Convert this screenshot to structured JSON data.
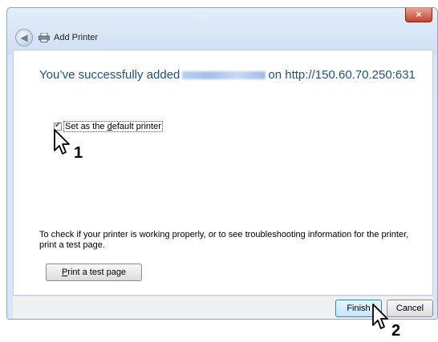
{
  "window": {
    "title": "Add Printer",
    "close_label": "×"
  },
  "content": {
    "headline_prefix": "You’ve successfully added",
    "headline_suffix": "on http://150.60.70.250:631",
    "checkbox": {
      "checked": true,
      "label_before": "Set as the ",
      "label_mnemonic": "d",
      "label_after": "efault printer"
    },
    "info_text": "To check if your printer is working properly, or to see troubleshooting information for the printer, print a test page.",
    "test_button": {
      "mnemonic": "P",
      "label_rest": "rint a test page"
    }
  },
  "footer": {
    "finish_label": "Finish",
    "cancel_label": "Cancel"
  },
  "annotations": {
    "step1": "1",
    "step2": "2"
  },
  "icons": [
    "close-icon",
    "back-arrow-icon",
    "printer-icon",
    "checkmark-icon",
    "mouse-cursor-icon"
  ]
}
